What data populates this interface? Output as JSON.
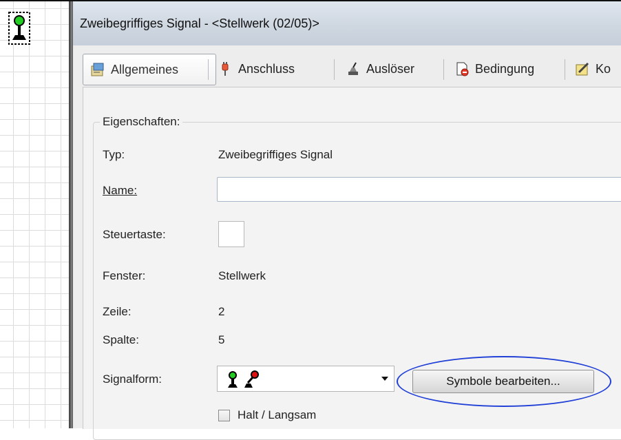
{
  "window": {
    "title": "Zweibegriffiges Signal - <Stellwerk (02/05)>"
  },
  "tabs": [
    {
      "label": "Allgemeines",
      "icon": "properties-icon",
      "active": true
    },
    {
      "label": "Anschluss",
      "icon": "plug-icon",
      "active": false
    },
    {
      "label": "Auslöser",
      "icon": "trigger-icon",
      "active": false
    },
    {
      "label": "Bedingung",
      "icon": "condition-icon",
      "active": false
    },
    {
      "label": "Ko",
      "icon": "note-icon",
      "active": false
    }
  ],
  "properties": {
    "group_title": "Eigenschaften:",
    "typ_label": "Typ:",
    "typ_value": "Zweibegriffiges Signal",
    "name_label": "Name:",
    "name_value": "",
    "steuertaste_label": "Steuertaste:",
    "steuertaste_value": "",
    "fenster_label": "Fenster:",
    "fenster_value": "Stellwerk",
    "zeile_label": "Zeile:",
    "zeile_value": "2",
    "spalte_label": "Spalte:",
    "spalte_value": "5",
    "signalform_label": "Signalform:",
    "signalform_selected_icons": [
      "signal-green-icon",
      "signal-red-icon"
    ],
    "edit_symbols_button": "Symbole bearbeiten...",
    "halt_checkbox_label": "Halt / Langsam",
    "halt_checked": false
  },
  "colors": {
    "signal_green": "#22cc22",
    "signal_red": "#dd1111",
    "highlight_ring": "#1f3fd6"
  }
}
